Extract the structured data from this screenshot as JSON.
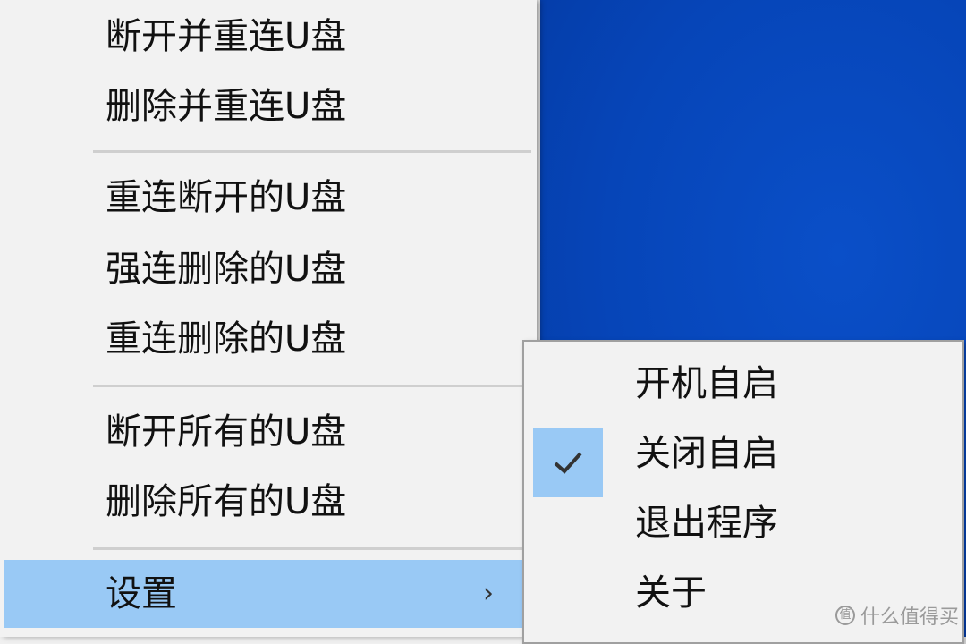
{
  "main_menu": {
    "items": [
      {
        "label": "断开并重连U盘"
      },
      {
        "label": "删除并重连U盘"
      },
      {
        "label": "重连断开的U盘"
      },
      {
        "label": "强连删除的U盘"
      },
      {
        "label": "重连删除的U盘"
      },
      {
        "label": "断开所有的U盘"
      },
      {
        "label": "删除所有的U盘"
      }
    ],
    "settings": {
      "label": "设置",
      "arrow": "›"
    }
  },
  "sub_menu": {
    "items": [
      {
        "label": "开机自启",
        "checked": false
      },
      {
        "label": "关闭自启",
        "checked": true
      },
      {
        "label": "退出程序",
        "checked": false
      },
      {
        "label": "关于",
        "checked": false
      }
    ]
  },
  "watermark": {
    "icon": "值",
    "text": "什么值得买"
  },
  "colors": {
    "menu_bg": "#f2f2f2",
    "highlight": "#99c9f5",
    "desktop": "#0645b8",
    "separator": "#cfcfcf"
  }
}
